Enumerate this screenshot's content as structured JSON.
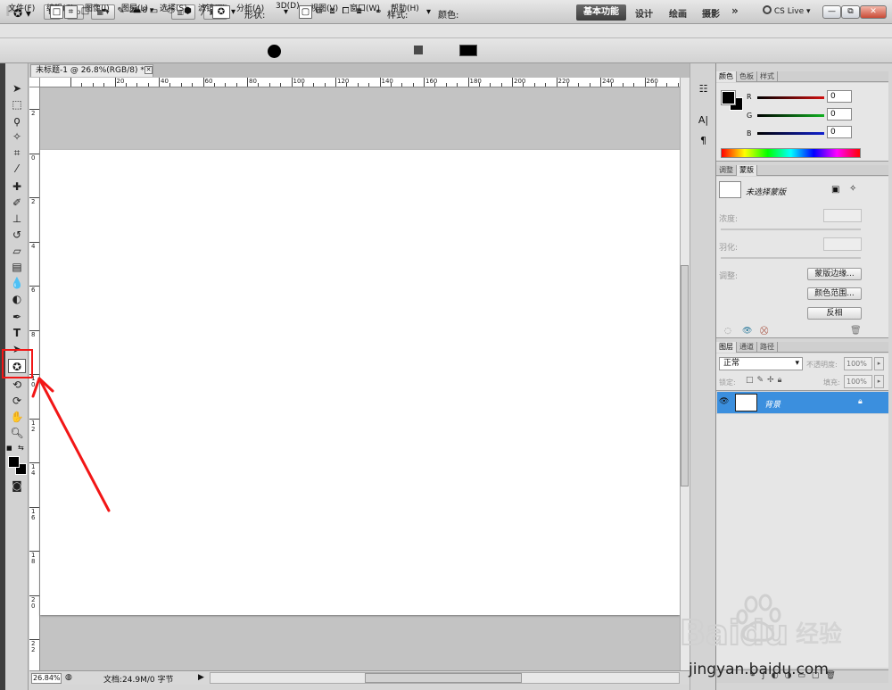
{
  "appbar": {
    "logo": "Ps",
    "bridge_btn": "Br",
    "minibridge_btn": "Mb",
    "zoom": "26.8",
    "workspaces": [
      "基本功能",
      "设计",
      "绘画",
      "摄影"
    ],
    "more": "»",
    "cslive": "CS Live"
  },
  "menu": [
    "文件(F)",
    "编辑(E)",
    "图像(I)",
    "图层(L)",
    "选择(S)",
    "滤镜(T)",
    "分析(A)",
    "3D(D)",
    "视图(V)",
    "窗口(W)",
    "帮助(H)"
  ],
  "options": {
    "shape_label": "形状:",
    "style_label": "样式:",
    "color_label": "颜色:",
    "color": "#000000"
  },
  "document": {
    "tab_title": "未标题-1 @ 26.8%(RGB/8) *",
    "ruler_h": [
      "20",
      "40",
      "60",
      "80",
      "100",
      "120",
      "140",
      "160",
      "180",
      "200",
      "220",
      "240",
      "260",
      "280"
    ],
    "ruler_v": [
      "2",
      "0",
      "2",
      "4",
      "6",
      "8",
      "10",
      "12",
      "14",
      "16",
      "18",
      "20",
      "22"
    ],
    "zoom_pct": "26.84%",
    "doc_info": "文档:24.9M/0 字节"
  },
  "color_panel": {
    "tabs": [
      "颜色",
      "色板",
      "样式"
    ],
    "channels": [
      {
        "label": "R",
        "value": "0",
        "color": "#d01010"
      },
      {
        "label": "G",
        "value": "0",
        "color": "#10b020"
      },
      {
        "label": "B",
        "value": "0",
        "color": "#1020d0"
      }
    ]
  },
  "masks_panel": {
    "tabs": [
      "调整",
      "蒙版"
    ],
    "title": "未选择蒙版",
    "density_label": "浓度:",
    "feather_label": "羽化:",
    "refine_label": "调整:",
    "buttons": [
      "蒙版边缘...",
      "颜色范围...",
      "反相"
    ]
  },
  "layers_panel": {
    "tabs": [
      "图层",
      "通道",
      "路径"
    ],
    "blend_mode": "正常",
    "opacity_label": "不透明度:",
    "opacity": "100%",
    "lock_label": "锁定:",
    "fill_label": "填充:",
    "fill": "100%",
    "layers": [
      {
        "name": "背景"
      }
    ]
  },
  "watermark": {
    "brand": "Baidu",
    "product": "经验",
    "url": "jingyan.baidu.com"
  }
}
